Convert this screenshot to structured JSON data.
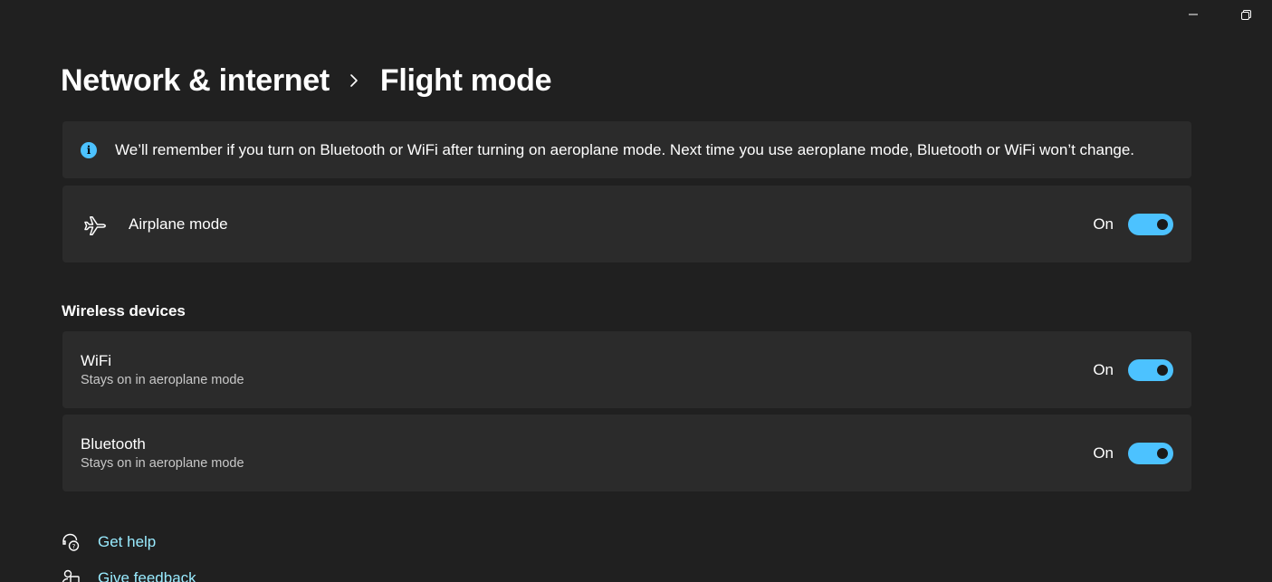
{
  "breadcrumb": {
    "parent": "Network & internet",
    "current": "Flight mode"
  },
  "info_bar": {
    "icon": "info-icon",
    "text": "We’ll remember if you turn on Bluetooth or WiFi after turning on aeroplane mode. Next time you use aeroplane mode, Bluetooth or WiFi won’t change."
  },
  "airplane": {
    "icon": "airplane-icon",
    "title": "Airplane mode",
    "state": "On",
    "enabled": true
  },
  "wireless": {
    "header": "Wireless devices",
    "items": [
      {
        "title": "WiFi",
        "subtitle": "Stays on in aeroplane mode",
        "state": "On",
        "enabled": true
      },
      {
        "title": "Bluetooth",
        "subtitle": "Stays on in aeroplane mode",
        "state": "On",
        "enabled": true
      }
    ]
  },
  "footer": {
    "help": {
      "icon": "help-icon",
      "label": "Get help"
    },
    "feedback": {
      "icon": "feedback-icon",
      "label": "Give feedback"
    }
  },
  "colors": {
    "background": "#202020",
    "card": "#2b2b2b",
    "accent": "#4cc2ff",
    "link": "#99ebff"
  }
}
